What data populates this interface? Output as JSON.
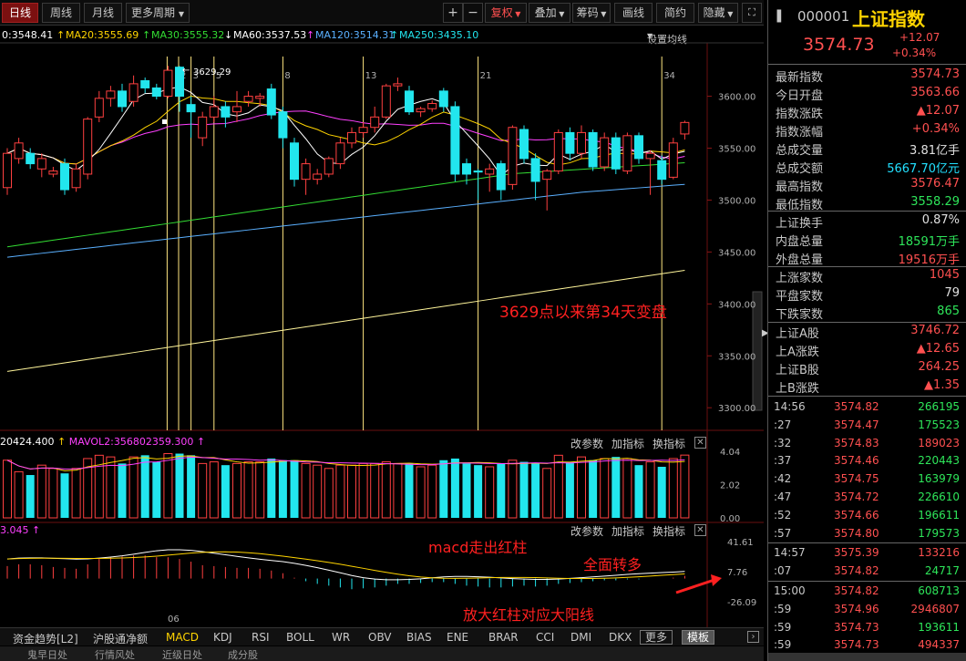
{
  "toolbar": {
    "periods": [
      "日线",
      "周线",
      "月线",
      "更多周期"
    ],
    "active_period": "日线",
    "zoom_in": "+",
    "zoom_out": "−",
    "buttons": [
      "复权",
      "叠加",
      "筹码",
      "画线",
      "简约",
      "隐藏"
    ]
  },
  "ma_header": {
    "ma5": "0:3548.41",
    "ma20": "MA20:3555.69",
    "ma30": "MA30:3555.32",
    "ma60": "MA60:3537.53",
    "ma120": "MA120:3514.31",
    "ma250": "MA250:3435.10",
    "setting": "设置均线"
  },
  "colors": {
    "up": "#ff4040",
    "down": "#22e6ee",
    "ma5": "#ffffff",
    "ma20": "#ffd400",
    "ma30": "#ff40ff",
    "ma60": "#33dd33",
    "ma120": "#5ab0ff",
    "ma250": "#fff59a"
  },
  "price_axis": [
    "3600.00",
    "3550.00",
    "3500.00",
    "3450.00",
    "3400.00",
    "3350.00",
    "3300.00"
  ],
  "vol_axis": [
    "4.04",
    "2.02",
    "0.00"
  ],
  "macd_axis": [
    "41.61",
    "7.76",
    "-26.09"
  ],
  "fib_labels": [
    "2",
    "3",
    "5",
    "8",
    "13",
    "21",
    "34"
  ],
  "peak_label": "3629.29",
  "x_label": "06",
  "annotations": {
    "main": "3629点以来第34天变盘",
    "macd1": "macd走出红柱",
    "macd2": "全面转多",
    "macd3": "放大红柱对应大阳线"
  },
  "volume_header": {
    "vol": "20424.400",
    "mavol2": "MAVOL2:356802359.300",
    "buttons": [
      "改参数",
      "加指标",
      "换指标"
    ]
  },
  "macd_header": {
    "val": "3.045",
    "buttons": [
      "改参数",
      "加指标",
      "换指标"
    ]
  },
  "bottom_tabs": [
    "资金趋势[L2]",
    "沪股通净额",
    "MACD",
    "KDJ",
    "RSI",
    "BOLL",
    "WR",
    "OBV",
    "BIAS",
    "ENE",
    "BRAR",
    "CCI",
    "DMI",
    "DKX"
  ],
  "active_tab": "MACD",
  "more_btn": "更多",
  "template_btn": "模板",
  "bottom_bar": [
    "鬼早日处",
    "行情风处",
    "近级日处",
    "成分股"
  ],
  "quote": {
    "code": "000001",
    "name": "上证指数",
    "price": "3574.73",
    "change": "+12.07",
    "change_pct": "+0.34%",
    "rows": [
      {
        "k": "最新指数",
        "v": "3574.73",
        "c": "red"
      },
      {
        "k": "今日开盘",
        "v": "3563.66",
        "c": "red"
      },
      {
        "k": "指数涨跌",
        "v": "▲12.07",
        "c": "red"
      },
      {
        "k": "指数涨幅",
        "v": "+0.34%",
        "c": "red"
      },
      {
        "k": "总成交量",
        "v": "3.81亿手",
        "c": "white"
      },
      {
        "k": "总成交额",
        "v": "5667.70亿元",
        "c": "cyan"
      },
      {
        "k": "最高指数",
        "v": "3576.47",
        "c": "red"
      },
      {
        "k": "最低指数",
        "v": "3558.29",
        "c": "green"
      }
    ],
    "rows2": [
      {
        "k": "上证换手",
        "v": "0.87%",
        "c": "white"
      },
      {
        "k": "内盘总量",
        "v": "18591万手",
        "c": "green"
      },
      {
        "k": "外盘总量",
        "v": "19516万手",
        "c": "red"
      }
    ],
    "rows3": [
      {
        "k": "上涨家数",
        "v": "1045",
        "c": "red"
      },
      {
        "k": "平盘家数",
        "v": "79",
        "c": "white"
      },
      {
        "k": "下跌家数",
        "v": "865",
        "c": "green"
      }
    ],
    "rows4": [
      {
        "k": "上证A股",
        "v": "3746.72",
        "c": "red"
      },
      {
        "k": "上A涨跌",
        "v": "▲12.65",
        "c": "red"
      },
      {
        "k": "上证B股",
        "v": "264.25",
        "c": "red"
      },
      {
        "k": "上B涨跌",
        "v": "▲1.35",
        "c": "red"
      }
    ]
  },
  "ticks": [
    {
      "t": "14:56",
      "p": "3574.82",
      "v": "266195",
      "c": "green"
    },
    {
      "t": ":27",
      "p": "3574.47",
      "v": "175523",
      "c": "green"
    },
    {
      "t": ":32",
      "p": "3574.83",
      "v": "189023",
      "c": "red"
    },
    {
      "t": ":37",
      "p": "3574.46",
      "v": "220443",
      "c": "green"
    },
    {
      "t": ":42",
      "p": "3574.75",
      "v": "163979",
      "c": "green"
    },
    {
      "t": ":47",
      "p": "3574.72",
      "v": "226610",
      "c": "green"
    },
    {
      "t": ":52",
      "p": "3574.66",
      "v": "196611",
      "c": "green"
    },
    {
      "t": ":57",
      "p": "3574.80",
      "v": "179573",
      "c": "green"
    },
    {
      "t": "14:57",
      "p": "3575.39",
      "v": "133216",
      "c": "red"
    },
    {
      "t": ":07",
      "p": "3574.82",
      "v": "24717",
      "c": "green"
    },
    {
      "t": "15:00",
      "p": "3574.82",
      "v": "608713",
      "c": "green"
    },
    {
      "t": ":59",
      "p": "3574.96",
      "v": "2946807",
      "c": "red"
    },
    {
      "t": ":59",
      "p": "3574.73",
      "v": "193611",
      "c": "green"
    },
    {
      "t": ":59",
      "p": "3574.73",
      "v": "494337",
      "c": "red"
    }
  ],
  "chart_data": {
    "type": "candlestick",
    "ylim": [
      3280,
      3640
    ],
    "candles": [
      [
        3512,
        3545,
        3505,
        3550,
        "up"
      ],
      [
        3540,
        3555,
        3535,
        3560,
        "up"
      ],
      [
        3545,
        3535,
        3530,
        3550,
        "down"
      ],
      [
        3530,
        3540,
        3522,
        3545,
        "up"
      ],
      [
        3525,
        3528,
        3522,
        3532,
        "up"
      ],
      [
        3535,
        3510,
        3505,
        3540,
        "down"
      ],
      [
        3512,
        3530,
        3508,
        3535,
        "up"
      ],
      [
        3525,
        3578,
        3520,
        3580,
        "up"
      ],
      [
        3580,
        3598,
        3575,
        3605,
        "up"
      ],
      [
        3598,
        3605,
        3590,
        3610,
        "up"
      ],
      [
        3605,
        3590,
        3585,
        3612,
        "down"
      ],
      [
        3595,
        3612,
        3590,
        3620,
        "up"
      ],
      [
        3615,
        3608,
        3603,
        3618,
        "down"
      ],
      [
        3608,
        3600,
        3597,
        3612,
        "down"
      ],
      [
        3600,
        3625,
        3598,
        3629.29,
        "up"
      ],
      [
        3628,
        3600,
        3585,
        3629,
        "down"
      ],
      [
        3592,
        3585,
        3560,
        3600,
        "down"
      ],
      [
        3580,
        3560,
        3552,
        3585,
        "up"
      ],
      [
        3580,
        3590,
        3575,
        3600,
        "up"
      ],
      [
        3590,
        3580,
        3570,
        3595,
        "down"
      ],
      [
        3585,
        3590,
        3575,
        3605,
        "up"
      ],
      [
        3595,
        3600,
        3590,
        3605,
        "up"
      ],
      [
        3600,
        3598,
        3590,
        3603,
        "up"
      ],
      [
        3607,
        3582,
        3578,
        3612,
        "down"
      ],
      [
        3585,
        3560,
        3550,
        3590,
        "down"
      ],
      [
        3555,
        3520,
        3513,
        3560,
        "down"
      ],
      [
        3520,
        3535,
        3505,
        3540,
        "up"
      ],
      [
        3520,
        3525,
        3515,
        3530,
        "up"
      ],
      [
        3525,
        3540,
        3522,
        3542,
        "up"
      ],
      [
        3535,
        3555,
        3530,
        3560,
        "up"
      ],
      [
        3555,
        3565,
        3550,
        3570,
        "up"
      ],
      [
        3565,
        3570,
        3560,
        3575,
        "up"
      ],
      [
        3570,
        3580,
        3565,
        3590,
        "up"
      ],
      [
        3580,
        3610,
        3578,
        3612,
        "up"
      ],
      [
        3610,
        3612,
        3605,
        3618,
        "up"
      ],
      [
        3605,
        3585,
        3582,
        3610,
        "down"
      ],
      [
        3585,
        3588,
        3580,
        3590,
        "up"
      ],
      [
        3588,
        3593,
        3585,
        3596,
        "up"
      ],
      [
        3605,
        3590,
        3585,
        3608,
        "down"
      ],
      [
        3590,
        3525,
        3518,
        3595,
        "down"
      ],
      [
        3535,
        3525,
        3515,
        3540,
        "down"
      ],
      [
        3527,
        3528,
        3500,
        3530,
        "down"
      ],
      [
        3525,
        3530,
        3508,
        3535,
        "up"
      ],
      [
        3535,
        3510,
        3500,
        3538,
        "down"
      ],
      [
        3515,
        3570,
        3510,
        3572,
        "up"
      ],
      [
        3568,
        3540,
        3535,
        3572,
        "down"
      ],
      [
        3540,
        3518,
        3500,
        3545,
        "down"
      ],
      [
        3520,
        3528,
        3490,
        3530,
        "up"
      ],
      [
        3528,
        3565,
        3525,
        3568,
        "up"
      ],
      [
        3565,
        3545,
        3538,
        3570,
        "down"
      ],
      [
        3545,
        3565,
        3540,
        3572,
        "up"
      ],
      [
        3565,
        3532,
        3528,
        3568,
        "down"
      ],
      [
        3532,
        3560,
        3528,
        3565,
        "up"
      ],
      [
        3560,
        3530,
        3525,
        3565,
        "down"
      ],
      [
        3528,
        3562,
        3525,
        3565,
        "up"
      ],
      [
        3562,
        3540,
        3535,
        3565,
        "down"
      ],
      [
        3540,
        3545,
        3505,
        3548,
        "up"
      ],
      [
        3538,
        3520,
        3515,
        3543,
        "down"
      ],
      [
        3522,
        3555,
        3520,
        3560,
        "up"
      ],
      [
        3563.66,
        3574.73,
        3558.29,
        3576.47,
        "up"
      ]
    ],
    "volumes": [
      3.5,
      2.8,
      2.6,
      3.2,
      3.0,
      2.7,
      3.0,
      3.6,
      3.8,
      3.7,
      3.3,
      3.7,
      3.8,
      3.4,
      3.9,
      3.9,
      3.8,
      3.3,
      3.4,
      3.2,
      3.3,
      3.4,
      3.4,
      3.6,
      3.5,
      3.5,
      3.3,
      3.2,
      3.0,
      3.2,
      3.2,
      3.3,
      3.3,
      3.4,
      3.3,
      3.3,
      3.1,
      3.2,
      3.5,
      3.6,
      3.3,
      3.2,
      3.1,
      3.3,
      3.5,
      3.4,
      3.3,
      3.0,
      3.8,
      3.4,
      3.7,
      3.5,
      3.6,
      3.7,
      3.6,
      3.2,
      3.4,
      3.1,
      3.6,
      3.81
    ],
    "macd": [
      14,
      16,
      16,
      15,
      13,
      12,
      11,
      16,
      22,
      24,
      25,
      26,
      26,
      24,
      24,
      22,
      19,
      15,
      14,
      13,
      12,
      12,
      11,
      9,
      6,
      1,
      -3,
      -6,
      -8,
      -10,
      -12,
      -11,
      -10,
      -8,
      -6,
      -6,
      -5,
      -4,
      -4,
      -6,
      -8,
      -9,
      -10,
      -10,
      -9,
      -8,
      -9,
      -8,
      -6,
      -5,
      -4,
      -3,
      -2,
      -2,
      -1,
      -1,
      0,
      0,
      1,
      3.045
    ]
  }
}
